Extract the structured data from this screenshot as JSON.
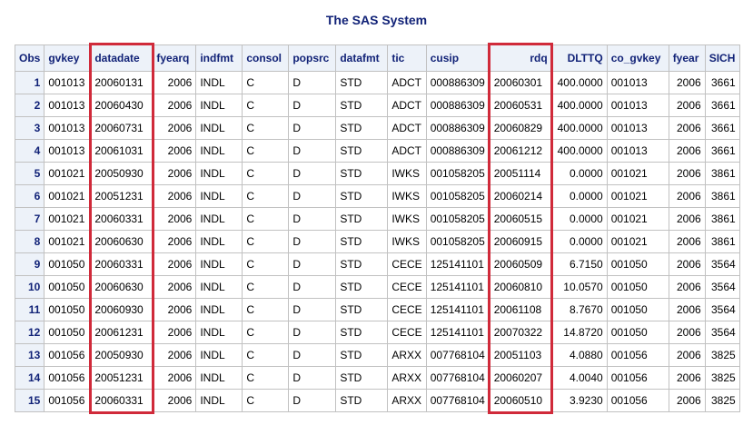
{
  "report": {
    "title": "The SAS System"
  },
  "table": {
    "headers": [
      "Obs",
      "gvkey",
      "datadate",
      "fyearq",
      "indfmt",
      "consol",
      "popsrc",
      "datafmt",
      "tic",
      "cusip",
      "rdq",
      "DLTTQ",
      "co_gvkey",
      "fyear",
      "SICH"
    ],
    "rows": [
      [
        "1",
        "001013",
        "20060131",
        "2006",
        "INDL",
        "C",
        "D",
        "STD",
        "ADCT",
        "000886309",
        "20060301",
        "400.0000",
        "001013",
        "2006",
        "3661"
      ],
      [
        "2",
        "001013",
        "20060430",
        "2006",
        "INDL",
        "C",
        "D",
        "STD",
        "ADCT",
        "000886309",
        "20060531",
        "400.0000",
        "001013",
        "2006",
        "3661"
      ],
      [
        "3",
        "001013",
        "20060731",
        "2006",
        "INDL",
        "C",
        "D",
        "STD",
        "ADCT",
        "000886309",
        "20060829",
        "400.0000",
        "001013",
        "2006",
        "3661"
      ],
      [
        "4",
        "001013",
        "20061031",
        "2006",
        "INDL",
        "C",
        "D",
        "STD",
        "ADCT",
        "000886309",
        "20061212",
        "400.0000",
        "001013",
        "2006",
        "3661"
      ],
      [
        "5",
        "001021",
        "20050930",
        "2006",
        "INDL",
        "C",
        "D",
        "STD",
        "IWKS",
        "001058205",
        "20051114",
        "0.0000",
        "001021",
        "2006",
        "3861"
      ],
      [
        "6",
        "001021",
        "20051231",
        "2006",
        "INDL",
        "C",
        "D",
        "STD",
        "IWKS",
        "001058205",
        "20060214",
        "0.0000",
        "001021",
        "2006",
        "3861"
      ],
      [
        "7",
        "001021",
        "20060331",
        "2006",
        "INDL",
        "C",
        "D",
        "STD",
        "IWKS",
        "001058205",
        "20060515",
        "0.0000",
        "001021",
        "2006",
        "3861"
      ],
      [
        "8",
        "001021",
        "20060630",
        "2006",
        "INDL",
        "C",
        "D",
        "STD",
        "IWKS",
        "001058205",
        "20060915",
        "0.0000",
        "001021",
        "2006",
        "3861"
      ],
      [
        "9",
        "001050",
        "20060331",
        "2006",
        "INDL",
        "C",
        "D",
        "STD",
        "CECE",
        "125141101",
        "20060509",
        "6.7150",
        "001050",
        "2006",
        "3564"
      ],
      [
        "10",
        "001050",
        "20060630",
        "2006",
        "INDL",
        "C",
        "D",
        "STD",
        "CECE",
        "125141101",
        "20060810",
        "10.0570",
        "001050",
        "2006",
        "3564"
      ],
      [
        "11",
        "001050",
        "20060930",
        "2006",
        "INDL",
        "C",
        "D",
        "STD",
        "CECE",
        "125141101",
        "20061108",
        "8.7670",
        "001050",
        "2006",
        "3564"
      ],
      [
        "12",
        "001050",
        "20061231",
        "2006",
        "INDL",
        "C",
        "D",
        "STD",
        "CECE",
        "125141101",
        "20070322",
        "14.8720",
        "001050",
        "2006",
        "3564"
      ],
      [
        "13",
        "001056",
        "20050930",
        "2006",
        "INDL",
        "C",
        "D",
        "STD",
        "ARXX",
        "007768104",
        "20051103",
        "4.0880",
        "001056",
        "2006",
        "3825"
      ],
      [
        "14",
        "001056",
        "20051231",
        "2006",
        "INDL",
        "C",
        "D",
        "STD",
        "ARXX",
        "007768104",
        "20060207",
        "4.0040",
        "001056",
        "2006",
        "3825"
      ],
      [
        "15",
        "001056",
        "20060331",
        "2006",
        "INDL",
        "C",
        "D",
        "STD",
        "ARXX",
        "007768104",
        "20060510",
        "3.9230",
        "001056",
        "2006",
        "3825"
      ]
    ],
    "highlighted_columns": [
      "datadate",
      "rdq"
    ]
  },
  "colors": {
    "title": "#112277",
    "header_background": "#edf2f9",
    "border": "#c1c1c1",
    "highlight": "#d02a3a"
  }
}
